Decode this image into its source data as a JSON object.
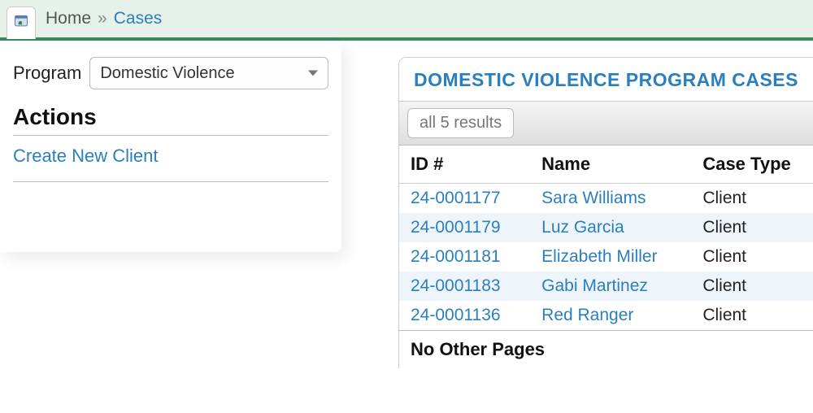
{
  "breadcrumb": {
    "home_label": "Home",
    "separator": "»",
    "cases_label": "Cases"
  },
  "sidebar": {
    "program_label": "Program",
    "program_selected": "Domestic Violence",
    "actions_heading": "Actions",
    "create_client_label": "Create New Client"
  },
  "main": {
    "tab_title": "DOMESTIC VIOLENCE PROGRAM CASES",
    "results_button": "all 5 results",
    "columns": {
      "id": "ID #",
      "name": "Name",
      "case_type": "Case Type"
    },
    "rows": [
      {
        "id": "24-0001177",
        "name": "Sara Williams",
        "case_type": "Client"
      },
      {
        "id": "24-0001179",
        "name": "Luz Garcia",
        "case_type": "Client"
      },
      {
        "id": "24-0001181",
        "name": "Elizabeth Miller",
        "case_type": "Client"
      },
      {
        "id": "24-0001183",
        "name": "Gabi Martinez",
        "case_type": "Client"
      },
      {
        "id": "24-0001136",
        "name": "Red Ranger",
        "case_type": "Client"
      }
    ],
    "pager_text": "No Other Pages"
  }
}
